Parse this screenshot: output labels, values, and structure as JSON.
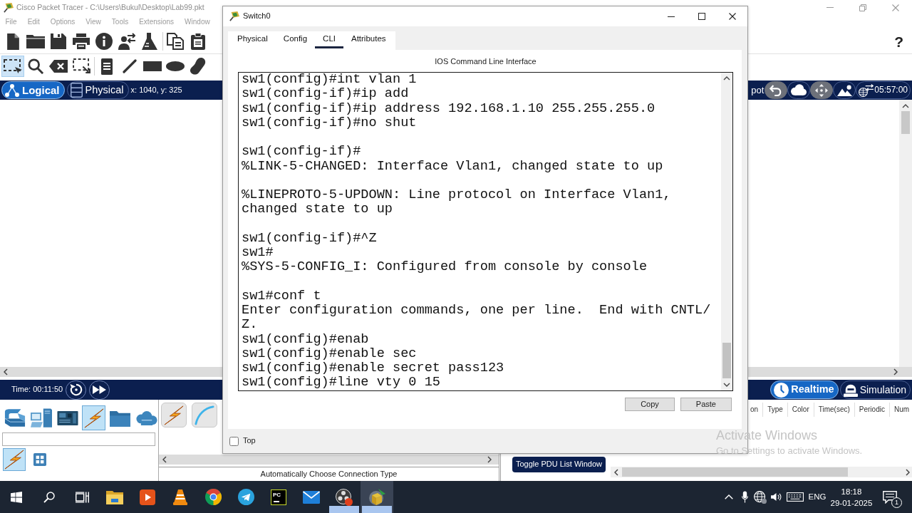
{
  "main_window": {
    "title": "Cisco Packet Tracer - C:\\Users\\Bukul\\Desktop\\Lab99.pkt",
    "menu": [
      "File",
      "Edit",
      "Options",
      "View",
      "Tools",
      "Extensions",
      "Window"
    ],
    "help": "?"
  },
  "drawing_tools": [
    {
      "selected": true
    },
    {
      "selected": false
    },
    {
      "selected": false
    },
    {
      "selected": false
    },
    {
      "selected": false
    },
    {
      "selected": false
    },
    {
      "selected": false
    },
    {
      "selected": false
    },
    {
      "selected": false
    }
  ],
  "workspace_bar": {
    "views": [
      {
        "label": "Logical",
        "selected": true
      },
      {
        "label": "Physical",
        "selected": false
      }
    ],
    "coordinates": "x: 1040, y: 325",
    "cut_label": "pot",
    "clock": "05:57:00"
  },
  "time_bar": {
    "time": "Time: 00:11:50",
    "modes": [
      {
        "label": "Realtime",
        "selected": true
      },
      {
        "label": "Simulation",
        "selected": false
      }
    ]
  },
  "device_categories": [
    {
      "selected": false
    },
    {
      "selected": false
    },
    {
      "selected": false
    },
    {
      "selected": true
    },
    {
      "selected": false
    },
    {
      "selected": false
    }
  ],
  "device_subcategories": [
    {
      "selected": true
    },
    {
      "selected": false
    }
  ],
  "connection_type": "Automatically Choose Connection Type",
  "pdu_list": {
    "columns": [
      "on",
      "Type",
      "Color",
      "Time(sec)",
      "Periodic",
      "Num"
    ],
    "toggle_button": "Toggle PDU List Window"
  },
  "switch_window": {
    "title": "Switch0",
    "tabs": [
      {
        "label": "Physical",
        "selected": false
      },
      {
        "label": "Config",
        "selected": false
      },
      {
        "label": "CLI",
        "selected": true
      },
      {
        "label": "Attributes",
        "selected": false
      }
    ],
    "cli_heading": "IOS Command Line Interface",
    "output_blocks": [
      [
        "sw1(config)#int vlan 1",
        "sw1(config-if)#ip add",
        "sw1(config-if)#ip address 192.168.1.10 255.255.255.0",
        "sw1(config-if)#no shut"
      ],
      [
        "sw1(config-if)#",
        "%LINK-5-CHANGED: Interface Vlan1, changed state to up"
      ],
      [
        "%LINEPROTO-5-UPDOWN: Line protocol on Interface Vlan1,",
        "changed state to up"
      ],
      [
        "sw1(config-if)#^Z",
        "sw1#",
        "%SYS-5-CONFIG_I: Configured from console by console"
      ],
      [
        "sw1#conf t",
        "Enter configuration commands, one per line.  End with CNTL/",
        "Z.",
        "sw1(config)#enab",
        "sw1(config)#enable sec",
        "sw1(config)#enable secret pass123",
        "sw1(config)#line vty 0 15"
      ]
    ],
    "buttons": [
      "Copy",
      "Paste"
    ],
    "top_checkbox": {
      "label": "Top",
      "checked": false
    }
  },
  "activation_notice": {
    "title": "Activate Windows",
    "text": "Go to Settings to activate Windows."
  },
  "taskbar": {
    "apps": [
      {
        "running": false,
        "active": false
      },
      {
        "running": false,
        "active": false
      },
      {
        "running": false,
        "active": false
      },
      {
        "running": false,
        "active": false
      },
      {
        "running": false,
        "active": false
      },
      {
        "running": false,
        "active": false,
        "logo_text": "PC"
      },
      {
        "running": false,
        "active": false
      },
      {
        "running": true,
        "active": false
      },
      {
        "running": true,
        "active": true
      }
    ],
    "language": "ENG",
    "time": "18:18",
    "date": "29-01-2025",
    "notification_count": "1"
  }
}
